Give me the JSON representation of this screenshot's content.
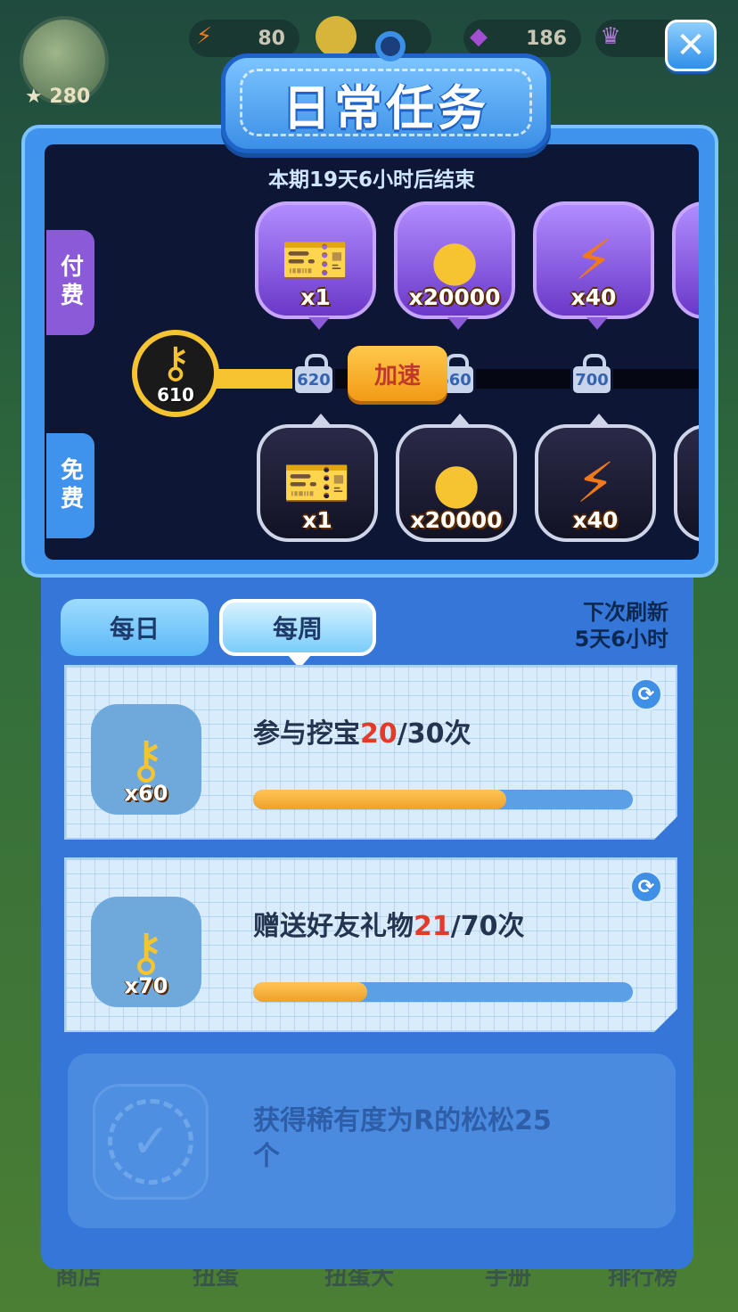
{
  "hud": {
    "avatar_stars": "280",
    "resources": [
      {
        "icon": "lightning-icon",
        "value": "80"
      },
      {
        "icon": "coin-icon",
        "value": ""
      },
      {
        "icon": "gem-icon",
        "value": "186"
      },
      {
        "icon": "crown-icon",
        "value": ""
      }
    ]
  },
  "title": "日常任务",
  "track": {
    "period": "本期19天6小时后结束",
    "paid_tab": "付费",
    "free_tab": "免费",
    "current_keys": "610",
    "speed_button": "加速",
    "milestones": [
      "620",
      "660",
      "700"
    ],
    "paid_rewards": [
      {
        "icon": "ticket-icon",
        "count": "x1"
      },
      {
        "icon": "coin-icon",
        "count": "x20000"
      },
      {
        "icon": "lightning-icon",
        "count": "x40"
      }
    ],
    "free_rewards": [
      {
        "icon": "ticket-icon",
        "count": "x1"
      },
      {
        "icon": "coin-icon",
        "count": "x20000"
      },
      {
        "icon": "lightning-icon",
        "count": "x40"
      }
    ]
  },
  "tabs": {
    "daily": "每日",
    "weekly": "每周"
  },
  "refresh": {
    "label": "下次刷新",
    "time": "5天6小时"
  },
  "tasks": [
    {
      "reward": "x60",
      "title": "参与挖宝",
      "current": "20",
      "total": "/30次",
      "progress": 0.6667
    },
    {
      "reward": "x70",
      "title": "赠送好友礼物",
      "current": "21",
      "total": "/70次",
      "progress": 0.3
    }
  ],
  "completed_task": {
    "title": "获得稀有度为R的松松25个"
  },
  "bottom_nav": [
    "商店",
    "扭蛋",
    "扭蛋大",
    "手册",
    "排行榜"
  ]
}
